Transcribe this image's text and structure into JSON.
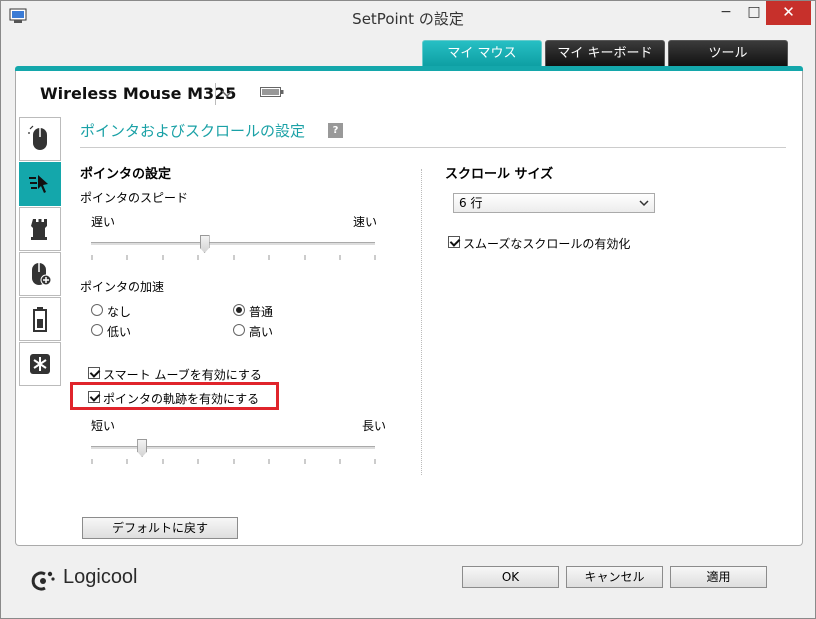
{
  "window": {
    "title": "SetPoint の設定",
    "min_glyph": "−",
    "max_glyph": "□",
    "close_glyph": "✕"
  },
  "tabs": [
    {
      "label": "マイ マウス",
      "active": true
    },
    {
      "label": "マイ キーボード",
      "active": false
    },
    {
      "label": "ツール",
      "active": false
    }
  ],
  "device": {
    "name": "Wireless Mouse M325"
  },
  "sidebar": {
    "items": [
      {
        "icon": "mouse-buttons-icon",
        "active": false
      },
      {
        "icon": "pointer-icon",
        "active": true
      },
      {
        "icon": "game-tower-icon",
        "active": false
      },
      {
        "icon": "mouse-plus-icon",
        "active": false
      },
      {
        "icon": "battery-icon",
        "active": false
      },
      {
        "icon": "settings-star-icon",
        "active": false
      }
    ]
  },
  "section": {
    "title": "ポインタおよびスクロールの設定",
    "help": "?"
  },
  "pointer": {
    "heading": "ポインタの設定",
    "speed_label": "ポインタのスピード",
    "speed_slow": "遅い",
    "speed_fast": "速い",
    "speed_value": 0.4,
    "accel_label": "ポインタの加速",
    "accel_options": [
      "なし",
      "普通",
      "低い",
      "高い"
    ],
    "accel_selected": "普通",
    "smart_move_label": "スマート ムーブを有効にする",
    "smart_move_checked": true,
    "trail_label": "ポインタの軌跡を有効にする",
    "trail_checked": true,
    "trail_short": "短い",
    "trail_long": "長い",
    "trail_value": 0.18
  },
  "scroll": {
    "heading": "スクロール サイズ",
    "size_value": "6 行",
    "smooth_label": "スムーズなスクロールの有効化",
    "smooth_checked": true
  },
  "buttons": {
    "default": "デフォルトに戻す",
    "ok": "OK",
    "cancel": "キャンセル",
    "apply": "適用"
  },
  "logo": {
    "text": "Logicool"
  },
  "colors": {
    "accent": "#14a7ab",
    "highlight": "#e0242b",
    "close": "#c7302b"
  }
}
